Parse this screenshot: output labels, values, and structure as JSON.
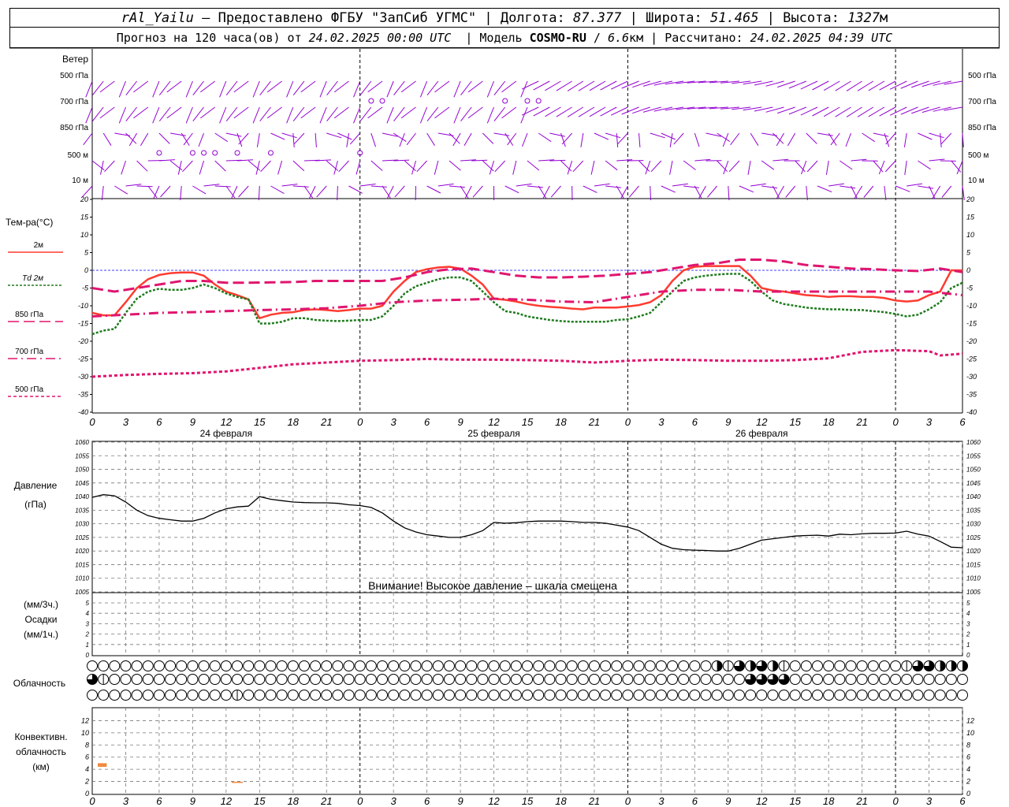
{
  "header": {
    "station": "rAl_Yailu",
    "provider_text": "— Предоставлено ФГБУ \"ЗапСиб УГМС\"",
    "lon_label": "Долгота:",
    "lon": "87.377",
    "lat_label": "Широта:",
    "lat": "51.465",
    "alt_label": "Высота:",
    "alt": "1327",
    "alt_unit": "м",
    "forecast_text": "Прогноз на 120 часа(ов) от",
    "forecast_start": "24.02.2025 00:00 UTC",
    "model_label": "Модель",
    "model": "COSMO-RU",
    "resolution": "6.6",
    "res_unit": "км",
    "calc_label": "Рассчитано:",
    "calc_time": "24.02.2025 04:39 UTC"
  },
  "chart_data": [
    {
      "type": "wind_barbs",
      "title": "Ветер",
      "levels": [
        "500 гПа",
        "700 гПа",
        "850 гПа",
        "500 м",
        "10 м"
      ],
      "colors": {
        "barb": "#9400d3",
        "calm": "#9400d3"
      }
    },
    {
      "type": "line",
      "ylabel": "Тем-ра(°C)",
      "ylim": [
        -40,
        20
      ],
      "yticks": [
        20,
        15,
        10,
        5,
        0,
        -5,
        -10,
        -15,
        -20,
        -25,
        -30,
        -35,
        -40
      ],
      "x_unit": "hours from 24.02.2025 00 UTC",
      "xlim": [
        0,
        78
      ],
      "x_tick_labels": [
        "0",
        "3",
        "6",
        "9",
        "12",
        "15",
        "18",
        "21",
        "0",
        "3",
        "6",
        "9",
        "12",
        "15",
        "18",
        "21",
        "0",
        "3",
        "6",
        "9",
        "12",
        "15",
        "18",
        "21",
        "0",
        "3",
        "6"
      ],
      "day_labels": [
        "24 февраля",
        "25 февраля",
        "26 февраля"
      ],
      "series": [
        {
          "name": "2м",
          "color": "#ff3b30",
          "style": "solid",
          "x": [
            0,
            1,
            2,
            3,
            4,
            5,
            6,
            7,
            8,
            9,
            10,
            11,
            12,
            13,
            14,
            15,
            16,
            17,
            18,
            19,
            20,
            21,
            22,
            23,
            24,
            25,
            26,
            27,
            28,
            29,
            30,
            31,
            32,
            33,
            34,
            35,
            36,
            37,
            38,
            39,
            40,
            41,
            42,
            43,
            44,
            45,
            46,
            47,
            48,
            49,
            50,
            51,
            52,
            53,
            54,
            55,
            56,
            57,
            58,
            59,
            60,
            61,
            62,
            63,
            64,
            65,
            66,
            67,
            68,
            69,
            70,
            71,
            72,
            73,
            74,
            75,
            76,
            77,
            78
          ],
          "y": [
            -12,
            -12.7,
            -12.7,
            -9,
            -5,
            -2.5,
            -1.3,
            -0.8,
            -0.6,
            -0.6,
            -1.5,
            -4,
            -6,
            -7,
            -8.2,
            -13.5,
            -12.5,
            -12,
            -11.8,
            -11.2,
            -11,
            -11.2,
            -11.5,
            -11.2,
            -10.8,
            -10.8,
            -10,
            -6,
            -3,
            -0.5,
            0.3,
            0.8,
            1,
            0.5,
            -1.5,
            -4,
            -8,
            -8.3,
            -8.8,
            -9.5,
            -10,
            -10.3,
            -10.5,
            -10.8,
            -11,
            -10.5,
            -10.5,
            -10.5,
            -10.2,
            -9.8,
            -9,
            -7,
            -3,
            0,
            1,
            1.2,
            1.2,
            1.2,
            1.2,
            -1.5,
            -5,
            -5.7,
            -6,
            -6.5,
            -7,
            -7.2,
            -7.5,
            -7.3,
            -7.3,
            -7.5,
            -7.5,
            -7.8,
            -8.5,
            -8.8,
            -8.5,
            -7,
            -6,
            0,
            0
          ]
        },
        {
          "name": "Td 2м",
          "color": "#1e7b1e",
          "style": "dotted",
          "x": [
            0,
            1,
            2,
            3,
            4,
            5,
            6,
            7,
            8,
            9,
            10,
            11,
            12,
            13,
            14,
            15,
            16,
            17,
            18,
            19,
            20,
            21,
            22,
            23,
            24,
            25,
            26,
            27,
            28,
            29,
            30,
            31,
            32,
            33,
            34,
            35,
            36,
            37,
            38,
            39,
            40,
            41,
            42,
            43,
            44,
            45,
            46,
            47,
            48,
            49,
            50,
            51,
            52,
            53,
            54,
            55,
            56,
            57,
            58,
            59,
            60,
            61,
            62,
            63,
            64,
            65,
            66,
            67,
            68,
            69,
            70,
            71,
            72,
            73,
            74,
            75,
            76,
            77,
            78
          ],
          "y": [
            -18,
            -17,
            -16.5,
            -12,
            -8,
            -6,
            -5.2,
            -5.5,
            -5.5,
            -5,
            -4,
            -5,
            -6.5,
            -7.5,
            -8.2,
            -15,
            -15,
            -14.5,
            -13.5,
            -13.5,
            -14,
            -14.2,
            -14.3,
            -14.2,
            -14,
            -14,
            -13,
            -10,
            -6.5,
            -4.5,
            -3.5,
            -2.5,
            -2,
            -2,
            -3,
            -6,
            -9,
            -11.5,
            -12,
            -13,
            -13.5,
            -14,
            -14.3,
            -14.5,
            -14.5,
            -14.5,
            -14.5,
            -14,
            -13.8,
            -13,
            -12,
            -9,
            -6,
            -3,
            -2,
            -1.5,
            -1.2,
            -1,
            -1,
            -3,
            -6,
            -8.5,
            -9.5,
            -10,
            -10.5,
            -10.8,
            -11,
            -11,
            -11.2,
            -11.2,
            -11.5,
            -11.8,
            -12.3,
            -13,
            -12.5,
            -11,
            -9,
            -5,
            -3.5
          ]
        },
        {
          "name": "850 гПа",
          "color": "#e0156f",
          "style": "longdash",
          "x": [
            0,
            2,
            4,
            6,
            8,
            10,
            12,
            14,
            16,
            18,
            20,
            22,
            24,
            26,
            28,
            30,
            32,
            34,
            36,
            38,
            40,
            42,
            44,
            46,
            48,
            50,
            52,
            54,
            56,
            58,
            60,
            62,
            64,
            66,
            68,
            70,
            72,
            74,
            76,
            78
          ],
          "y": [
            -5,
            -6,
            -5,
            -4,
            -3,
            -3,
            -3.5,
            -3.5,
            -3.4,
            -3.3,
            -3,
            -3,
            -3,
            -3,
            -2,
            -0.5,
            0.3,
            0.5,
            -0.5,
            -1.5,
            -2,
            -2,
            -1.8,
            -1.5,
            -1,
            -0.5,
            0.5,
            1.5,
            2,
            3,
            3,
            2.5,
            1.5,
            1,
            0.5,
            0.3,
            0,
            -0.2,
            0.5,
            -0.5
          ]
        },
        {
          "name": "700 гПа",
          "color": "#e0156f",
          "style": "dashdot",
          "x": [
            0,
            3,
            6,
            9,
            12,
            15,
            18,
            21,
            24,
            27,
            30,
            33,
            36,
            39,
            42,
            45,
            48,
            51,
            54,
            57,
            60,
            63,
            66,
            69,
            72,
            75,
            78
          ],
          "y": [
            -13,
            -12.5,
            -12,
            -11.8,
            -11.5,
            -11.2,
            -11,
            -10.7,
            -10,
            -9,
            -8.5,
            -8.3,
            -8,
            -8.3,
            -8.8,
            -9,
            -7.5,
            -6,
            -5.5,
            -5.5,
            -6,
            -6,
            -6,
            -6,
            -6,
            -6,
            -7
          ]
        },
        {
          "name": "500 гПа",
          "color": "#e0156f",
          "style": "shortdash",
          "x": [
            0,
            3,
            6,
            9,
            12,
            15,
            18,
            21,
            24,
            27,
            30,
            33,
            36,
            39,
            42,
            45,
            48,
            51,
            54,
            57,
            60,
            63,
            66,
            69,
            72,
            75,
            76,
            78
          ],
          "y": [
            -30,
            -29.5,
            -29.2,
            -29,
            -28.5,
            -27.5,
            -26.5,
            -26,
            -25.5,
            -25.3,
            -25,
            -25.2,
            -25.2,
            -25.3,
            -25.5,
            -26,
            -25.5,
            -25.2,
            -25.3,
            -25.5,
            -25.5,
            -25.3,
            -24.8,
            -23,
            -22.5,
            -22.8,
            -24,
            -23.5
          ]
        }
      ]
    },
    {
      "type": "line",
      "ylabel": "Давление",
      "yunit": "(гПа)",
      "ylim": [
        1005,
        1060
      ],
      "yticks": [
        1060,
        1055,
        1050,
        1045,
        1040,
        1035,
        1030,
        1025,
        1020,
        1015,
        1010,
        1005
      ],
      "annotation": "Внимание! Высокое давление – шкала смещена",
      "series": [
        {
          "name": "Давление",
          "color": "#000000",
          "x": [
            0,
            1,
            2,
            3,
            4,
            5,
            6,
            7,
            8,
            9,
            10,
            11,
            12,
            13,
            14,
            15,
            16,
            17,
            18,
            19,
            20,
            21,
            22,
            23,
            24,
            25,
            26,
            27,
            28,
            29,
            30,
            31,
            32,
            33,
            34,
            35,
            36,
            37,
            38,
            39,
            40,
            41,
            42,
            43,
            44,
            45,
            46,
            47,
            48,
            49,
            50,
            51,
            52,
            53,
            54,
            55,
            56,
            57,
            58,
            59,
            60,
            61,
            62,
            63,
            64,
            65,
            66,
            67,
            68,
            69,
            70,
            71,
            72,
            73,
            74,
            75,
            76,
            77,
            78
          ],
          "y": [
            1039.7,
            1040.7,
            1040.3,
            1038,
            1035,
            1033,
            1032,
            1031.5,
            1031,
            1031,
            1032,
            1034,
            1035.5,
            1036.2,
            1036.5,
            1040,
            1039,
            1038.5,
            1038,
            1037.8,
            1037.7,
            1037.7,
            1037.5,
            1037,
            1036.7,
            1036,
            1034,
            1031,
            1028.5,
            1027,
            1026,
            1025.5,
            1025,
            1025,
            1026,
            1027.5,
            1030.5,
            1030.2,
            1030.4,
            1030.8,
            1031,
            1031,
            1031,
            1030.8,
            1030.5,
            1030.5,
            1030.2,
            1029.5,
            1028.8,
            1027.5,
            1025,
            1022.5,
            1021,
            1020.5,
            1020.3,
            1020.2,
            1020,
            1020,
            1021,
            1022.5,
            1024,
            1024.5,
            1025,
            1025.5,
            1025.7,
            1025.8,
            1025.5,
            1026.2,
            1026,
            1026.3,
            1026.5,
            1026.5,
            1026.6,
            1027.3,
            1026.2,
            1025.5,
            1023.5,
            1021.4,
            1021.2
          ]
        }
      ]
    },
    {
      "type": "bar",
      "ylabel_top": "(мм/3ч.)",
      "ylabel_mid": "Осадки",
      "ylabel_bot": "(мм/1ч.)",
      "ylim": [
        0,
        5
      ],
      "yticks": [
        5,
        4,
        3,
        2,
        1,
        0
      ],
      "values": []
    },
    {
      "type": "cloud_symbols",
      "title": "Облачность",
      "rows": 3,
      "columns": 79,
      "cover": [
        [
          0,
          0,
          0,
          0,
          0,
          0,
          0,
          0,
          0,
          0,
          0,
          0,
          0,
          0,
          0,
          0,
          0,
          0,
          0,
          0,
          0,
          0,
          0,
          0,
          0,
          0,
          0,
          0,
          0,
          0,
          0,
          0,
          0,
          0,
          0,
          0,
          0,
          0,
          0,
          0,
          0,
          0,
          0,
          0,
          0,
          0,
          0,
          0,
          0,
          0,
          0,
          0,
          0,
          0,
          0,
          0,
          2,
          1,
          3,
          2,
          3,
          2,
          1,
          0,
          0,
          0,
          0,
          0,
          0,
          0,
          0,
          0,
          0,
          1,
          3,
          3,
          2,
          2,
          2,
          2,
          2,
          4,
          2,
          4
        ],
        [
          3,
          1,
          0,
          0,
          0,
          0,
          0,
          0,
          0,
          0,
          0,
          0,
          0,
          0,
          0,
          0,
          0,
          0,
          0,
          0,
          0,
          0,
          0,
          0,
          0,
          0,
          0,
          0,
          0,
          0,
          0,
          0,
          0,
          0,
          0,
          0,
          0,
          0,
          0,
          0,
          0,
          0,
          0,
          0,
          0,
          0,
          0,
          0,
          0,
          0,
          0,
          0,
          0,
          0,
          0,
          0,
          0,
          0,
          0,
          3,
          3,
          3,
          3,
          0,
          0,
          0,
          0,
          0,
          0,
          0,
          0,
          0,
          0,
          0,
          0,
          0,
          0,
          0,
          0,
          0,
          0,
          0,
          0
        ],
        [
          0,
          0,
          0,
          0,
          0,
          0,
          0,
          0,
          0,
          0,
          0,
          0,
          0,
          1,
          0,
          0,
          0,
          0,
          0,
          0,
          0,
          0,
          0,
          0,
          0,
          0,
          0,
          0,
          0,
          0,
          0,
          0,
          0,
          0,
          0,
          0,
          0,
          0,
          0,
          0,
          0,
          0,
          0,
          0,
          0,
          0,
          0,
          0,
          0,
          0,
          0,
          0,
          0,
          0,
          0,
          0,
          0,
          0,
          0,
          0,
          0,
          0,
          0,
          0,
          0,
          0,
          0,
          0,
          0,
          0,
          0,
          0,
          0,
          0,
          0,
          0,
          0,
          0,
          0
        ]
      ]
    },
    {
      "type": "bar",
      "ylabel": "Конвективн. облачность (км)",
      "ylabel_lines": [
        "Конвективн.",
        "облачность",
        "(км)"
      ],
      "ylim": [
        0,
        14
      ],
      "yticks": [
        12,
        10,
        8,
        6,
        4,
        2,
        0
      ],
      "color": "#f08a3c",
      "segments": [
        {
          "x": [
            0.5,
            1.3
          ],
          "bottom": 4.4,
          "top": 5.0
        },
        {
          "x": [
            12.5,
            13.5
          ],
          "bottom": 1.8,
          "top": 1.95
        }
      ]
    }
  ],
  "colors": {
    "wind": "#9400d3",
    "grid": "#777777",
    "zero_line": "#4040ff"
  }
}
